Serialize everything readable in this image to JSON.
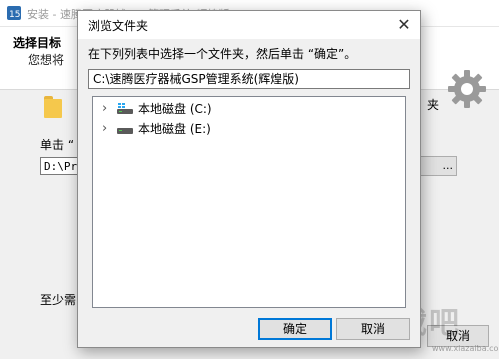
{
  "installer": {
    "title": "安装 - 速腾医疗器械GSP管理系统(辉煌版)",
    "heading": "选择目标",
    "subheading": "您想将",
    "folder_suffix": "夹",
    "click_prompt": "单击 “",
    "install_path": "D:\\Pr",
    "browse_label": "...",
    "space_label": "至少需",
    "cancel_label": "取消"
  },
  "dialog": {
    "title": "浏览文件夹",
    "close_glyph": "✕",
    "instruction": "在下列列表中选择一个文件夹，然后单击 “确定”。",
    "selected_path": "C:\\速腾医疗器械GSP管理系统(辉煌版)",
    "tree": [
      {
        "label": "本地磁盘 (C:)",
        "selected": true
      },
      {
        "label": "本地磁盘 (E:)",
        "selected": false
      }
    ],
    "ok_label": "确定",
    "cancel_label": "取消"
  },
  "icons": {
    "expand": "chevron-right-icon",
    "drive": "hard-drive-icon",
    "gear": "gear-icon",
    "folder": "folder-icon"
  },
  "colors": {
    "accent": "#0078d7",
    "folder": "#f5c84c",
    "windows_logo": "#2aa7f0"
  },
  "watermark": {
    "text": "下载吧",
    "url": "www.xiazaiba.com"
  }
}
